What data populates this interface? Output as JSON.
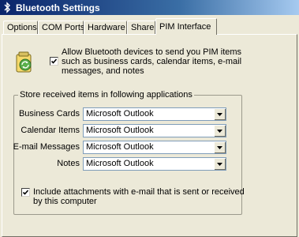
{
  "window": {
    "title": "Bluetooth Settings"
  },
  "tabs": [
    {
      "label": "Options"
    },
    {
      "label": "COM Ports"
    },
    {
      "label": "Hardware"
    },
    {
      "label": "Share"
    },
    {
      "label": "PIM Interface"
    }
  ],
  "active_tab": "PIM Interface",
  "allow_pim": {
    "label": "Allow Bluetooth devices to send you PIM items such as business cards, calendar items, e-mail messages, and notes",
    "checked": true
  },
  "store_group": {
    "title": "Store received items in following applications",
    "rows": [
      {
        "label": "Business Cards",
        "value": "Microsoft Outlook"
      },
      {
        "label": "Calendar Items",
        "value": "Microsoft Outlook"
      },
      {
        "label": "E-mail Messages",
        "value": "Microsoft Outlook"
      },
      {
        "label": "Notes",
        "value": "Microsoft Outlook"
      }
    ]
  },
  "include_attachments": {
    "label": "Include attachments with e-mail that is sent or received by this computer",
    "checked": true
  },
  "icons": [
    "bluetooth-icon",
    "pim-sync-icon",
    "checkmark-icon",
    "dropdown-arrow-icon"
  ]
}
